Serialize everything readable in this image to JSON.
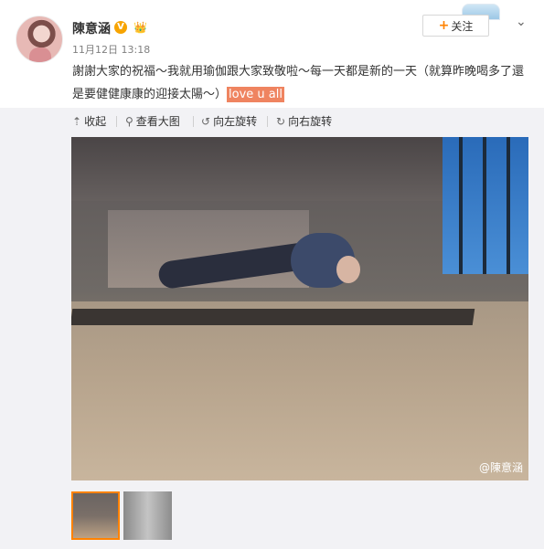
{
  "user": {
    "name": "陳意涵",
    "verified_badge": "V",
    "member_badge": "👑",
    "time": "11月12日 13:18"
  },
  "header": {
    "follow_plus": "+",
    "follow_label": "关注",
    "more_icon": "chevron-down-icon"
  },
  "post": {
    "text_main": "謝謝大家的祝福～我就用瑜伽跟大家致敬啦～每一天都是新的一天（就算昨晚喝多了還是要健健康康的迎接太陽～）",
    "text_highlight": "love u all"
  },
  "toolbar": {
    "collapse_label": "收起",
    "view_large_label": "查看大图",
    "rotate_left_label": "向左旋转",
    "rotate_right_label": "向右旋转"
  },
  "image": {
    "watermark": "@陳意涵",
    "selected_index": 1
  },
  "colors": {
    "accent": "#ff8200",
    "highlight_bg": "#ef8460",
    "toolbar_bg": "#f2f2f5"
  }
}
